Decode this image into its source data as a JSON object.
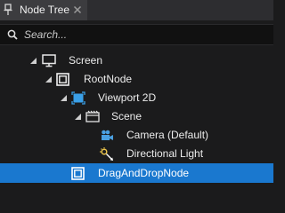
{
  "panel": {
    "tab_title": "Node Tree"
  },
  "search": {
    "placeholder": "Search..."
  },
  "tree": [
    {
      "label": "Screen",
      "icon": "monitor-icon",
      "expanded": true,
      "selected": false
    },
    {
      "label": "RootNode",
      "icon": "node-frame-icon",
      "expanded": true,
      "selected": false
    },
    {
      "label": "Viewport 2D",
      "icon": "viewport-2d-icon",
      "expanded": true,
      "selected": false
    },
    {
      "label": "Scene",
      "icon": "scene-icon",
      "expanded": true,
      "selected": false
    },
    {
      "label": "Camera (Default)",
      "icon": "camera-icon",
      "expanded": false,
      "selected": false
    },
    {
      "label": "Directional Light",
      "icon": "light-icon",
      "expanded": false,
      "selected": false
    },
    {
      "label": "DragAndDropNode",
      "icon": "node-frame-icon",
      "expanded": false,
      "selected": true
    }
  ],
  "colors": {
    "selection": "#1a78cf",
    "viewport_accent": "#3aa0e8"
  }
}
